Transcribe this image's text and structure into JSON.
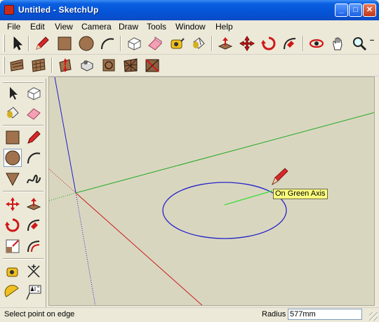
{
  "window": {
    "title": "Untitled - SketchUp"
  },
  "menu": [
    "File",
    "Edit",
    "View",
    "Camera",
    "Draw",
    "Tools",
    "Window",
    "Help"
  ],
  "toolbar_top": [
    {
      "name": "select-icon"
    },
    {
      "name": "pencil-line-icon"
    },
    {
      "name": "rectangle-icon"
    },
    {
      "name": "circle-icon"
    },
    {
      "name": "arc-icon"
    },
    {
      "name": "make-component-icon"
    },
    {
      "name": "eraser-icon"
    },
    {
      "name": "tape-measure-icon"
    },
    {
      "name": "paint-bucket-icon"
    },
    {
      "name": "push-pull-icon"
    },
    {
      "name": "move-icon"
    },
    {
      "name": "rotate-icon"
    },
    {
      "name": "follow-me-icon"
    },
    {
      "name": "orbit-icon"
    },
    {
      "name": "pan-icon"
    },
    {
      "name": "zoom-icon"
    },
    {
      "name": "zoom-extents-icon"
    }
  ],
  "toolbar_second": [
    {
      "name": "sandbox-from-contours-icon"
    },
    {
      "name": "sandbox-from-scratch-icon"
    },
    {
      "name": "smoove-icon"
    },
    {
      "name": "stamp-icon"
    },
    {
      "name": "drape-icon"
    },
    {
      "name": "add-detail-icon"
    },
    {
      "name": "flip-edge-icon"
    }
  ],
  "left_toolbar": [
    {
      "name": "select-icon"
    },
    {
      "name": "make-component-icon"
    },
    {
      "name": "paint-bucket-icon"
    },
    {
      "name": "eraser-icon"
    },
    {
      "name": "rectangle-icon"
    },
    {
      "name": "line-icon"
    },
    {
      "name": "circle-icon"
    },
    {
      "name": "arc-icon"
    },
    {
      "name": "polygon-icon"
    },
    {
      "name": "freehand-icon"
    },
    {
      "name": "move-icon"
    },
    {
      "name": "push-pull-icon"
    },
    {
      "name": "rotate-icon"
    },
    {
      "name": "follow-me-icon"
    },
    {
      "name": "scale-icon"
    },
    {
      "name": "offset-icon"
    },
    {
      "name": "tape-measure-icon"
    },
    {
      "name": "dimensions-icon"
    },
    {
      "name": "protractor-icon"
    },
    {
      "name": "text-icon"
    }
  ],
  "viewport": {
    "tooltip": "On Green Axis",
    "colors": {
      "background": "#d9d6c0",
      "red_axis": "#c81e1e",
      "green_axis": "#1fa81f",
      "blue_axis": "#1f1fc8",
      "circle": "#2424c8",
      "inference": "#3adc3a"
    }
  },
  "status": {
    "prompt": "Select point on edge",
    "vcb_label": "Radius",
    "vcb_value": "577mm"
  }
}
